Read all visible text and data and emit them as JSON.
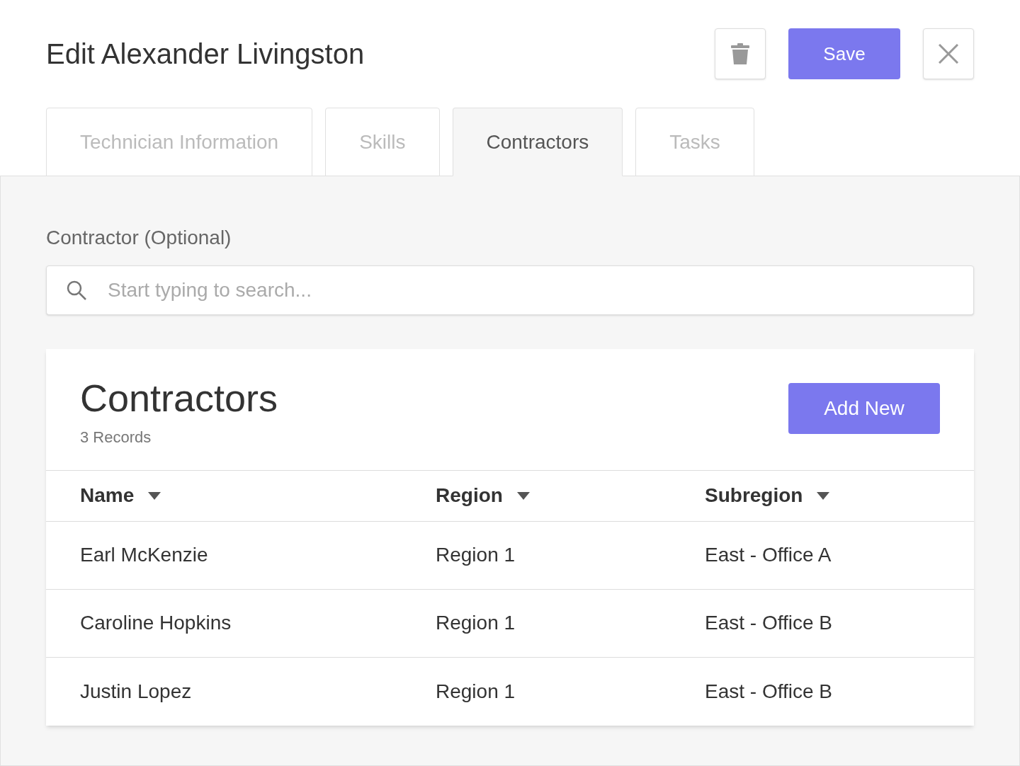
{
  "header": {
    "title": "Edit Alexander Livingston",
    "save_label": "Save"
  },
  "tabs": [
    {
      "label": "Technician Information",
      "selected": false
    },
    {
      "label": "Skills",
      "selected": false
    },
    {
      "label": "Contractors",
      "selected": true
    },
    {
      "label": "Tasks",
      "selected": false
    }
  ],
  "contractor_field": {
    "label": "Contractor (Optional)",
    "placeholder": "Start typing to search..."
  },
  "card": {
    "title": "Contractors",
    "count": "3 Records",
    "add_label": "Add New"
  },
  "table": {
    "columns": [
      "Name",
      "Region",
      "Subregion"
    ],
    "rows": [
      [
        "Earl McKenzie",
        "Region 1",
        "East - Office A"
      ],
      [
        "Caroline Hopkins",
        "Region 1",
        "East - Office B"
      ],
      [
        "Justin Lopez",
        "Region 1",
        "East - Office B"
      ]
    ]
  }
}
